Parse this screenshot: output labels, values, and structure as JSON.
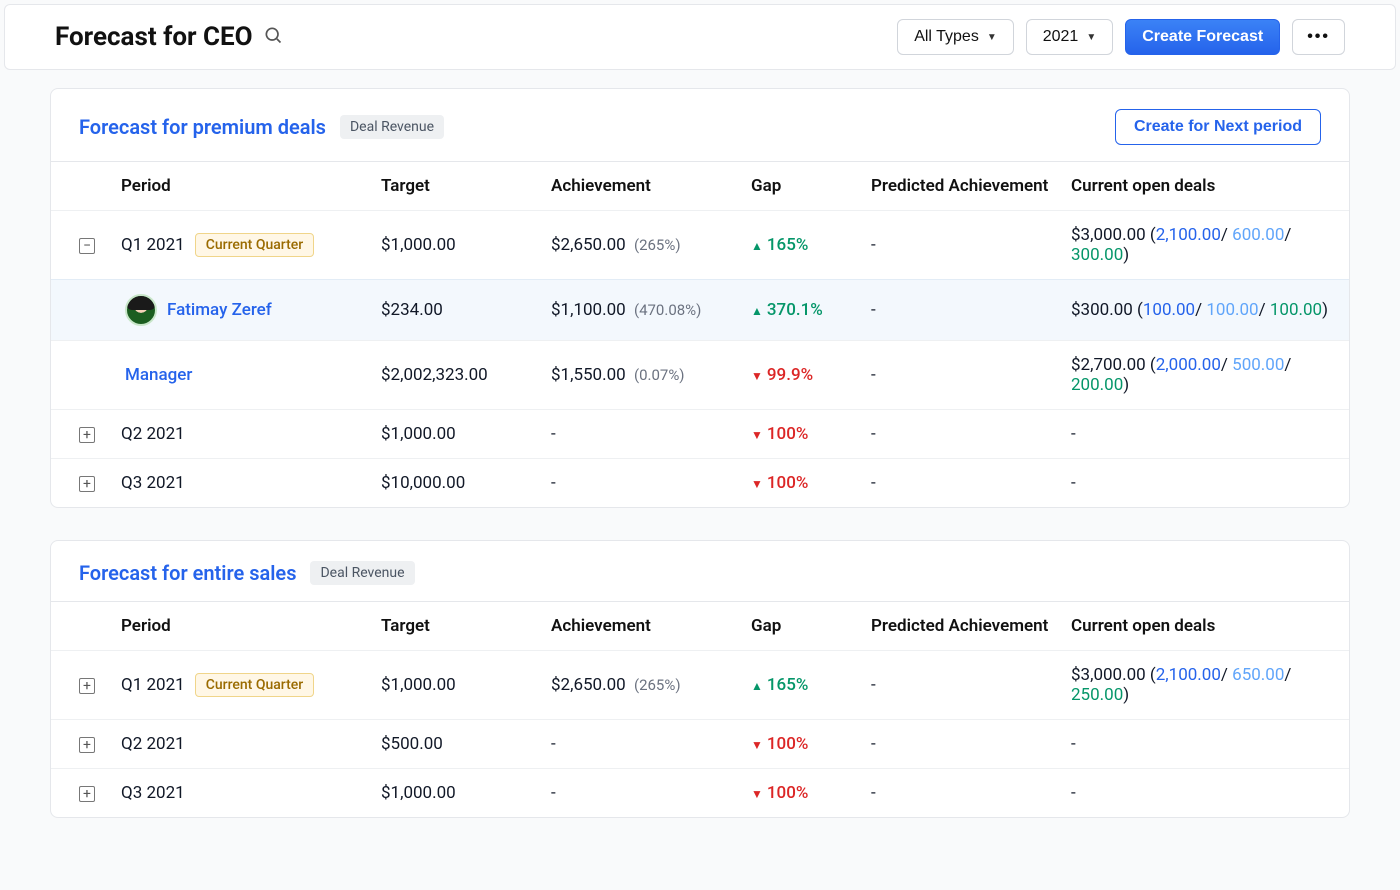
{
  "header": {
    "title": "Forecast for CEO",
    "filter_type": "All Types",
    "filter_year": "2021",
    "create_label": "Create Forecast"
  },
  "columns": {
    "period": "Period",
    "target": "Target",
    "achievement": "Achievement",
    "gap": "Gap",
    "predicted": "Predicted Achievement",
    "open": "Current open deals"
  },
  "sections": [
    {
      "title": "Forecast for premium deals",
      "tag": "Deal Revenue",
      "action": "Create for Next period",
      "rows": [
        {
          "kind": "period",
          "expand": "minus",
          "period": "Q1 2021",
          "current": "Current Quarter",
          "target": "$1,000.00",
          "achievement": "$2,650.00",
          "ach_pct": "(265%)",
          "gap_dir": "up",
          "gap": "165%",
          "predicted": "-",
          "open_total": "$3,000.00",
          "open_b1": "2,100.00",
          "open_b2": "600.00",
          "open_b3": "300.00"
        },
        {
          "kind": "user",
          "name": "Fatimay Zeref",
          "target": "$234.00",
          "achievement": "$1,100.00",
          "ach_pct": "(470.08%)",
          "gap_dir": "up",
          "gap": "370.1%",
          "predicted": "-",
          "open_total": "$300.00",
          "open_b1": "100.00",
          "open_b2": "100.00",
          "open_b3": "100.00"
        },
        {
          "kind": "link",
          "name": "Manager",
          "target": "$2,002,323.00",
          "achievement": "$1,550.00",
          "ach_pct": "(0.07%)",
          "gap_dir": "down",
          "gap": "99.9%",
          "predicted": "-",
          "open_total": "$2,700.00",
          "open_b1": "2,000.00",
          "open_b2": "500.00",
          "open_b3": "200.00"
        },
        {
          "kind": "period",
          "expand": "plus",
          "period": "Q2 2021",
          "target": "$1,000.00",
          "achievement": "-",
          "gap_dir": "down",
          "gap": "100%",
          "predicted": "-",
          "open_total": "-"
        },
        {
          "kind": "period",
          "expand": "plus",
          "period": "Q3 2021",
          "target": "$10,000.00",
          "achievement": "-",
          "gap_dir": "down",
          "gap": "100%",
          "predicted": "-",
          "open_total": "-"
        }
      ]
    },
    {
      "title": "Forecast for entire sales",
      "tag": "Deal Revenue",
      "rows": [
        {
          "kind": "period",
          "expand": "plus",
          "period": "Q1 2021",
          "current": "Current Quarter",
          "target": "$1,000.00",
          "achievement": "$2,650.00",
          "ach_pct": "(265%)",
          "gap_dir": "up",
          "gap": "165%",
          "predicted": "-",
          "open_total": "$3,000.00",
          "open_b1": "2,100.00",
          "open_b2": "650.00",
          "open_b3": "250.00"
        },
        {
          "kind": "period",
          "expand": "plus",
          "period": "Q2 2021",
          "target": "$500.00",
          "achievement": "-",
          "gap_dir": "down",
          "gap": "100%",
          "predicted": "-",
          "open_total": "-"
        },
        {
          "kind": "period",
          "expand": "plus",
          "period": "Q3 2021",
          "target": "$1,000.00",
          "achievement": "-",
          "gap_dir": "down",
          "gap": "100%",
          "predicted": "-",
          "open_total": "-"
        }
      ]
    }
  ]
}
